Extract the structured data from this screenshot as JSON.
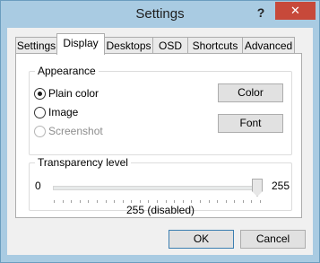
{
  "window": {
    "title": "Settings",
    "help_glyph": "?",
    "close_glyph": "✕"
  },
  "tabs": [
    {
      "label": "Settings",
      "active": false
    },
    {
      "label": "Display",
      "active": true
    },
    {
      "label": "Desktops",
      "active": false
    },
    {
      "label": "OSD",
      "active": false
    },
    {
      "label": "Shortcuts",
      "active": false
    },
    {
      "label": "Advanced",
      "active": false
    }
  ],
  "appearance": {
    "group_label": "Appearance",
    "options": [
      {
        "label": "Plain color",
        "checked": true,
        "disabled": false
      },
      {
        "label": "Image",
        "checked": false,
        "disabled": false
      },
      {
        "label": "Screenshot",
        "checked": false,
        "disabled": true
      }
    ],
    "color_button": "Color",
    "font_button": "Font"
  },
  "transparency": {
    "group_label": "Transparency level",
    "min_label": "0",
    "max_label": "255",
    "value_text": "255 (disabled)",
    "value_fraction": 1.0
  },
  "footer": {
    "ok_label": "OK",
    "cancel_label": "Cancel"
  },
  "icons": {
    "close": "close-icon",
    "help": "help-icon"
  }
}
